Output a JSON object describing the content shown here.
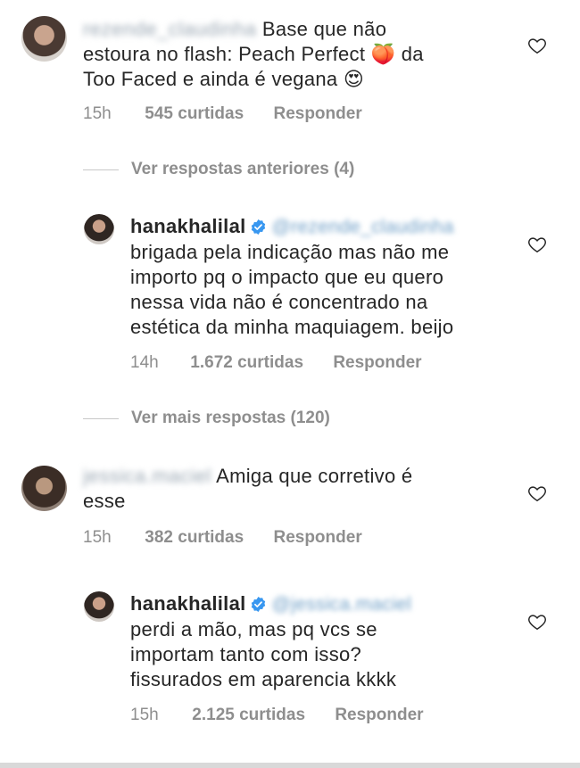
{
  "comments": [
    {
      "username": "rezende_claudinha",
      "text_line1": "Base que não",
      "text_line2": "estoura no flash: Peach Perfect 🍑 da",
      "text_line3": "Too Faced e ainda é vegana 😍",
      "time": "15h",
      "likes": "545 curtidas",
      "reply": "Responder"
    },
    {
      "username": "jessica.maciel",
      "text_line1": "Amiga que corretivo é",
      "text_line2": "esse",
      "time": "15h",
      "likes": "382 curtidas",
      "reply": "Responder"
    }
  ],
  "replies": [
    {
      "username": "hanakhalilal",
      "mention": "@rezende_claudinha",
      "lines": [
        "brigada pela indicação mas não me",
        "importo pq o impacto que eu quero",
        "nessa vida não é concentrado na",
        "estética da minha maquiagem. beijo"
      ],
      "time": "14h",
      "likes": "1.672 curtidas",
      "reply": "Responder"
    },
    {
      "username": "hanakhalilal",
      "mention": "@jessica.maciel",
      "lines": [
        "perdi a mão, mas pq vcs se",
        "importam tanto com isso?",
        "fissurados em aparencia kkkk"
      ],
      "time": "15h",
      "likes": "2.125 curtidas",
      "reply": "Responder"
    }
  ],
  "view_previous": "Ver respostas anteriores (4)",
  "view_more": "Ver mais respostas (120)",
  "colors": {
    "text": "#262626",
    "meta": "#8e8e8e",
    "verified": "#3897f0"
  }
}
